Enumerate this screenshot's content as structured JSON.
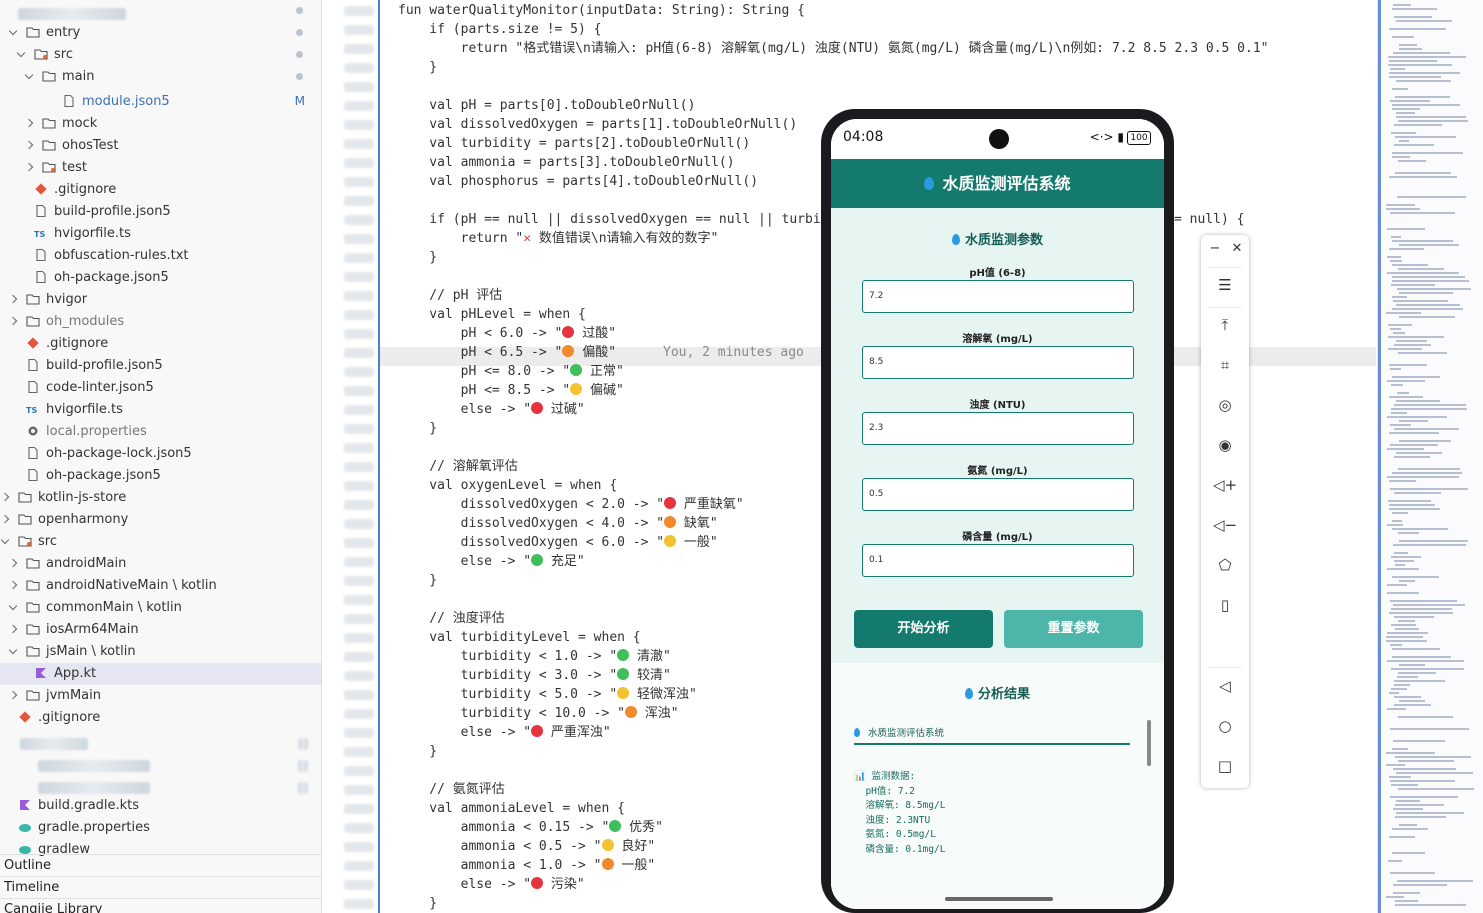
{
  "sidebar": {
    "items": [
      {
        "label": "entry",
        "badge": ""
      },
      {
        "label": "src",
        "badge": ""
      },
      {
        "label": "main",
        "badge": ""
      },
      {
        "label": "module.json5",
        "badge": "M"
      },
      {
        "label": "mock",
        "badge": ""
      },
      {
        "label": "ohosTest",
        "badge": ""
      },
      {
        "label": "test",
        "badge": ""
      },
      {
        "label": ".gitignore",
        "badge": ""
      },
      {
        "label": "build-profile.json5",
        "badge": ""
      },
      {
        "label": "hvigorfile.ts",
        "badge": ""
      },
      {
        "label": "obfuscation-rules.txt",
        "badge": ""
      },
      {
        "label": "oh-package.json5",
        "badge": ""
      },
      {
        "label": "hvigor",
        "badge": ""
      },
      {
        "label": "oh_modules",
        "badge": ""
      },
      {
        "label": ".gitignore",
        "badge": ""
      },
      {
        "label": "build-profile.json5",
        "badge": ""
      },
      {
        "label": "code-linter.json5",
        "badge": ""
      },
      {
        "label": "hvigorfile.ts",
        "badge": ""
      },
      {
        "label": "local.properties",
        "badge": ""
      },
      {
        "label": "oh-package-lock.json5",
        "badge": ""
      },
      {
        "label": "oh-package.json5",
        "badge": ""
      },
      {
        "label": "kotlin-js-store",
        "badge": ""
      },
      {
        "label": "openharmony",
        "badge": ""
      },
      {
        "label": "src",
        "badge": ""
      },
      {
        "label": "androidMain",
        "badge": ""
      },
      {
        "label": "androidNativeMain \\ kotlin",
        "badge": ""
      },
      {
        "label": "commonMain \\ kotlin",
        "badge": ""
      },
      {
        "label": "iosArm64Main",
        "badge": ""
      },
      {
        "label": "jsMain \\ kotlin",
        "badge": ""
      },
      {
        "label": "App.kt",
        "badge": ""
      },
      {
        "label": "jvmMain",
        "badge": ""
      },
      {
        "label": ".gitignore",
        "badge": ""
      },
      {
        "label": "build.gradle.kts",
        "badge": ""
      },
      {
        "label": "gradle.properties",
        "badge": ""
      },
      {
        "label": "gradlew",
        "badge": ""
      }
    ],
    "ts_icon": "TS",
    "panels": [
      "Outline",
      "Timeline",
      "Cangjie Library"
    ]
  },
  "editor": {
    "blame": "You, 2 minutes ago",
    "lines": [
      "fun waterQualityMonitor(inputData: String): String {",
      "    if (parts.size != 5) {",
      "        return \"格式错误\\n请输入: pH值(6-8) 溶解氧(mg/L) 浊度(NTU) 氨氮(mg/L) 磷含量(mg/L)\\n例如: 7.2 8.5 2.3 0.5 0.1\"",
      "    }",
      "",
      "    val pH = parts[0].toDoubleOrNull()",
      "    val dissolvedOxygen = parts[1].toDoubleOrNull()",
      "    val turbidity = parts[2].toDoubleOrNull()",
      "    val ammonia = parts[3].toDoubleOrNull()",
      "    val phosphorus = parts[4].toDoubleOrNull()",
      "",
      "    if (pH == null || dissolvedOxygen == null || turbid",
      "        return \"❌ 数值错误\\n请输入有效的数字\"",
      "    }",
      "",
      "    // pH 评估",
      "    val pHLevel = when {",
      "        pH < 6.0 -> \"🔴 过酸\"",
      "        pH < 6.5 -> \"🟠 偏酸\"",
      "        pH <= 8.0 -> \"🟢 正常\"",
      "        pH <= 8.5 -> \"🟡 偏碱\"",
      "        else -> \"🔴 过碱\"",
      "    }",
      "",
      "    // 溶解氧评估",
      "    val oxygenLevel = when {",
      "        dissolvedOxygen < 2.0 -> \"🔴 严重缺氧\"",
      "        dissolvedOxygen < 4.0 -> \"🟠 缺氧\"",
      "        dissolvedOxygen < 6.0 -> \"🟡 一般\"",
      "        else -> \"🟢 充足\"",
      "    }",
      "",
      "    // 浊度评估",
      "    val turbidityLevel = when {",
      "        turbidity < 1.0 -> \"🟢 清澈\"",
      "        turbidity < 3.0 -> \"🟢 较清\"",
      "        turbidity < 5.0 -> \"🟡 轻微浑浊\"",
      "        turbidity < 10.0 -> \"🟠 浑浊\"",
      "        else -> \"🔴 严重浑浊\"",
      "    }",
      "",
      "    // 氨氮评估",
      "    val ammoniaLevel = when {",
      "        ammonia < 0.15 -> \"🟢 优秀\"",
      "        ammonia < 0.5 -> \"🟡 良好\"",
      "        ammonia < 1.0 -> \"🟠 一般\"",
      "        else -> \"🔴 污染\"",
      "    }"
    ],
    "line11_tail": "= null) {"
  },
  "phone": {
    "time": "04:08",
    "signal": "<·> ▮",
    "battery": "100",
    "app_title": "水质监测评估系统",
    "params_title": "水质监测参数",
    "fields": [
      {
        "label": "pH值 (6-8)",
        "value": "7.2"
      },
      {
        "label": "溶解氧 (mg/L)",
        "value": "8.5"
      },
      {
        "label": "浊度 (NTU)",
        "value": "2.3"
      },
      {
        "label": "氨氮 (mg/L)",
        "value": "0.5"
      },
      {
        "label": "磷含量 (mg/L)",
        "value": "0.1"
      }
    ],
    "analyze_button": "开始分析",
    "reset_button": "重置参数",
    "result_title": "分析结果",
    "result_header": "水质监测评估系统",
    "result_lines": [
      "📊 监测数据:",
      "  pH值: 7.2",
      "  溶解氧: 8.5mg/L",
      "  浊度: 2.3NTU",
      "  氨氮: 0.5mg/L",
      "  磷含量: 0.1mg/L"
    ],
    "colors": {
      "primary": "#137a6d",
      "secondary": "#4db6a8",
      "panel": "#e6f4f2"
    }
  },
  "emulator_toolbar": {
    "icons": [
      "minimize-icon",
      "close-icon",
      "menu-icon",
      "pin-top-icon",
      "crop-screenshot-icon",
      "rotate-icon",
      "location-icon",
      "volume-up-icon",
      "volume-down-icon",
      "fold-icon",
      "unfold-icon",
      "back-icon",
      "home-icon",
      "recents-icon"
    ],
    "minimize": "−",
    "close": "✕",
    "menu": "☰",
    "pin_top": "⤒",
    "crop": "⌗",
    "rotate": "◎",
    "location": "◉",
    "vol_up": "◁+",
    "vol_down": "◁−",
    "fold": "⬠",
    "unfold": "▯",
    "back": "◁",
    "home": "○",
    "recents": "□"
  }
}
